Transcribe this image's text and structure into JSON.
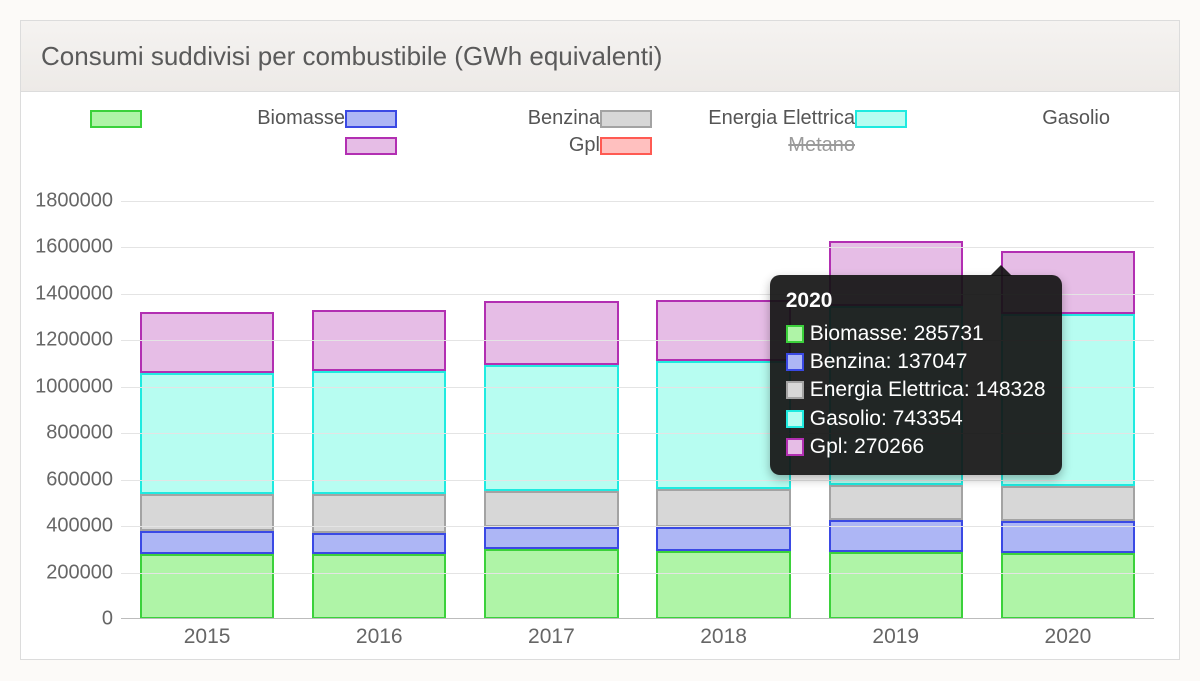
{
  "title": "Consumi suddivisi per combustibile (GWh equivalenti)",
  "colors": {
    "Biomasse": {
      "fill": "#aff4a7",
      "stroke": "#3bd13b"
    },
    "Benzina": {
      "fill": "#adb6f5",
      "stroke": "#3a49e4"
    },
    "Energia Elettrica": {
      "fill": "#d7d7d7",
      "stroke": "#a3a3a3"
    },
    "Gasolio": {
      "fill": "#b7fdf1",
      "stroke": "#1feae0"
    },
    "Gpl": {
      "fill": "#e6bde6",
      "stroke": "#b22fb2"
    },
    "Metano": {
      "fill": "#ffc0bf",
      "stroke": "#ff5a52"
    }
  },
  "legend_order": [
    "Biomasse",
    "Benzina",
    "Energia Elettrica",
    "Gasolio",
    "Gpl",
    "Metano"
  ],
  "disabled_series": [
    "Metano"
  ],
  "tooltip": {
    "category": "2020",
    "rows": [
      {
        "series": "Biomasse",
        "label": "Biomasse: 285731"
      },
      {
        "series": "Benzina",
        "label": "Benzina: 137047"
      },
      {
        "series": "Energia Elettrica",
        "label": "Energia Elettrica: 148328"
      },
      {
        "series": "Gasolio",
        "label": "Gasolio: 743354"
      },
      {
        "series": "Gpl",
        "label": "Gpl: 270266"
      }
    ]
  },
  "chart_data": {
    "type": "bar",
    "stacked": true,
    "title": "Consumi suddivisi per combustibile (GWh equivalenti)",
    "xlabel": "",
    "ylabel": "",
    "categories": [
      "2015",
      "2016",
      "2017",
      "2018",
      "2019",
      "2020"
    ],
    "ylim": [
      0,
      1800000
    ],
    "ytick_step": 200000,
    "series": [
      {
        "name": "Biomasse",
        "values": [
          280000,
          280000,
          300000,
          295000,
          290000,
          285731
        ]
      },
      {
        "name": "Benzina",
        "values": [
          100000,
          90000,
          95000,
          100000,
          138000,
          137047
        ]
      },
      {
        "name": "Energia Elettrica",
        "values": [
          160000,
          170000,
          155000,
          165000,
          150000,
          148328
        ]
      },
      {
        "name": "Gasolio",
        "values": [
          520000,
          530000,
          545000,
          550000,
          770000,
          743354
        ]
      },
      {
        "name": "Gpl",
        "values": [
          260000,
          260000,
          275000,
          265000,
          280000,
          270266
        ]
      },
      {
        "name": "Metano",
        "hidden": true,
        "values": [
          null,
          null,
          null,
          null,
          null,
          null
        ]
      }
    ],
    "legend_position": "top"
  }
}
